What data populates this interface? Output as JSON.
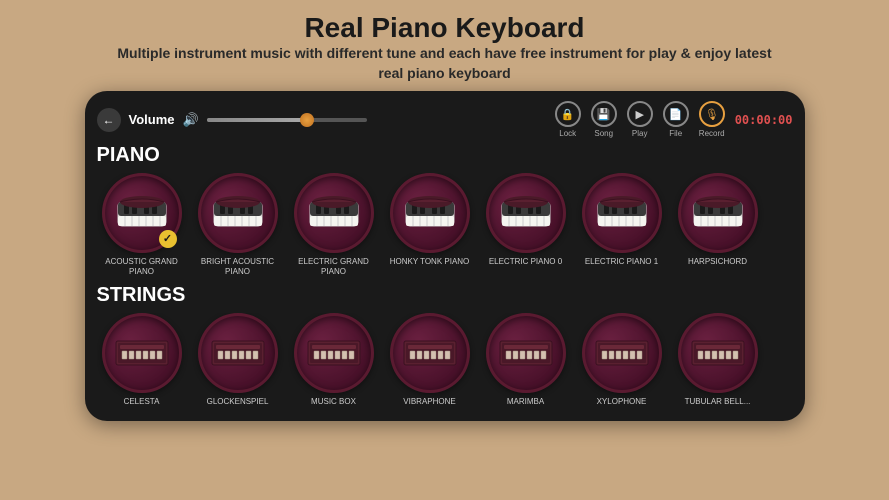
{
  "header": {
    "title": "Real Piano Keyboard",
    "subtitle": "Multiple instrument music with different tune and each have free instrument for play & enjoy latest real piano keyboard"
  },
  "phone": {
    "volume_label": "Volume",
    "timer": "00:00:00",
    "controls": [
      {
        "id": "lock",
        "label": "Lock",
        "icon": "🔒"
      },
      {
        "id": "song",
        "label": "Song",
        "icon": "💾"
      },
      {
        "id": "play",
        "label": "Play",
        "icon": "▶"
      },
      {
        "id": "file",
        "label": "File",
        "icon": "📄"
      },
      {
        "id": "record",
        "label": "Record",
        "icon": "🎙"
      }
    ],
    "sections": [
      {
        "title": "PIANO",
        "instruments": [
          {
            "name": "ACOUSTIC GRAND PIANO",
            "selected": true,
            "type": "piano"
          },
          {
            "name": "BRIGHT ACOUSTIC PIANO",
            "selected": false,
            "type": "piano"
          },
          {
            "name": "ELECTRIC GRAND PIANO",
            "selected": false,
            "type": "piano"
          },
          {
            "name": "HONKY TONK PIANO",
            "selected": false,
            "type": "piano"
          },
          {
            "name": "ELECTRIC PIANO 0",
            "selected": false,
            "type": "piano"
          },
          {
            "name": "ELECTRIC PIANO 1",
            "selected": false,
            "type": "piano"
          },
          {
            "name": "HARPSICHORD",
            "selected": false,
            "type": "piano"
          }
        ]
      },
      {
        "title": "STRINGS",
        "instruments": [
          {
            "name": "CELESTA",
            "selected": false,
            "type": "strings"
          },
          {
            "name": "GLOCKENSPIEL",
            "selected": false,
            "type": "strings"
          },
          {
            "name": "MUSIC BOX",
            "selected": false,
            "type": "strings"
          },
          {
            "name": "VIBRAPHONE",
            "selected": false,
            "type": "strings"
          },
          {
            "name": "MARIMBA",
            "selected": false,
            "type": "strings"
          },
          {
            "name": "XYLOPHONE",
            "selected": false,
            "type": "strings"
          },
          {
            "name": "TUBULAR BELL...",
            "selected": false,
            "type": "strings"
          }
        ]
      }
    ]
  }
}
